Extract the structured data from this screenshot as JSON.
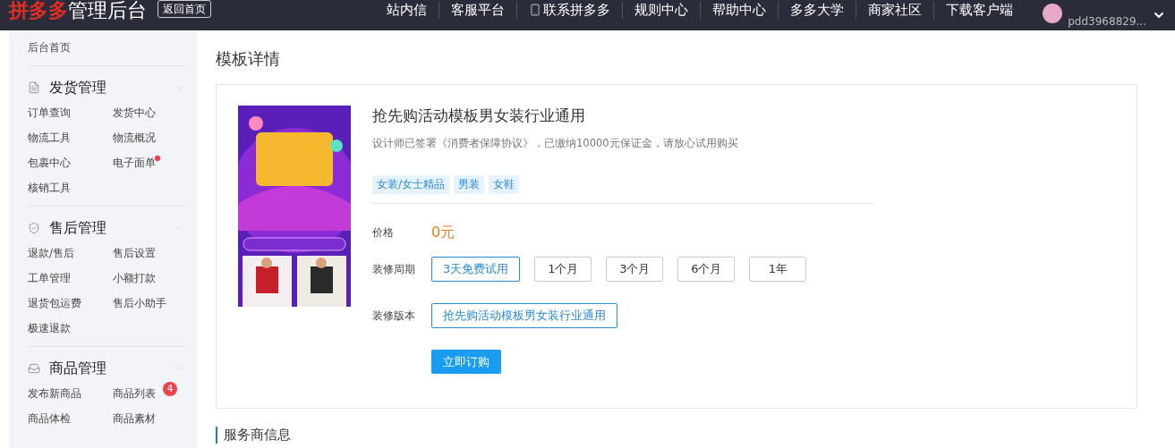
{
  "topbar": {
    "logo_brand": "拼多多",
    "logo_suffix": "管理后台",
    "home_button": "返回首页",
    "nav": [
      {
        "label": "站内信",
        "kind": "text"
      },
      {
        "label": "客服平台",
        "kind": "text"
      },
      {
        "label": "联系拼多多",
        "kind": "phone"
      },
      {
        "label": "规则中心",
        "kind": "text"
      },
      {
        "label": "帮助中心",
        "kind": "text"
      },
      {
        "label": "多多大学",
        "kind": "text"
      },
      {
        "label": "商家社区",
        "kind": "text"
      },
      {
        "label": "下载客户端",
        "kind": "text"
      }
    ],
    "user": {
      "id": "pdd3968829..."
    }
  },
  "sidebar": {
    "home": "后台首页",
    "groups": [
      {
        "title": "发货管理",
        "kind": "document",
        "items": [
          {
            "label": "订单查询",
            "new_dot": false
          },
          {
            "label": "发货中心",
            "new_dot": false
          },
          {
            "label": "物流工具",
            "new_dot": false
          },
          {
            "label": "物流概况",
            "new_dot": false
          },
          {
            "label": "包裹中心",
            "new_dot": false
          },
          {
            "label": "电子面单",
            "new_dot": true
          },
          {
            "label": "核销工具",
            "new_dot": false
          }
        ]
      },
      {
        "title": "售后管理",
        "kind": "shield",
        "items": [
          {
            "label": "退款/售后",
            "new_dot": false
          },
          {
            "label": "售后设置",
            "new_dot": false
          },
          {
            "label": "工单管理",
            "new_dot": false
          },
          {
            "label": "小额打款",
            "new_dot": false
          },
          {
            "label": "退货包运费",
            "new_dot": false
          },
          {
            "label": "售后小助手",
            "new_dot": false
          },
          {
            "label": "极速退款",
            "new_dot": false
          }
        ]
      },
      {
        "title": "商品管理",
        "kind": "tray",
        "items": [
          {
            "label": "发布新商品",
            "new_dot": false
          },
          {
            "label": "商品列表",
            "new_dot": false,
            "badge": "4"
          },
          {
            "label": "商品体检",
            "new_dot": false
          },
          {
            "label": "商品素材",
            "new_dot": false
          }
        ]
      }
    ]
  },
  "page": {
    "title": "模板详情",
    "template": {
      "name": "抢先购活动模板男女装行业通用",
      "note": "设计师已签署《消费者保障协议》，已缴纳10000元保证金，请放心试用购买",
      "tags": [
        "女装/女士精品",
        "男装",
        "女鞋"
      ],
      "price_label": "价格",
      "price": "0元",
      "period_label": "装修周期",
      "periods": [
        {
          "label": "3天免费试用",
          "selected": true
        },
        {
          "label": "1个月",
          "selected": false
        },
        {
          "label": "3个月",
          "selected": false
        },
        {
          "label": "6个月",
          "selected": false
        },
        {
          "label": "1年",
          "selected": false
        }
      ],
      "version_label": "装修版本",
      "versions": [
        {
          "label": "抢先购活动模板男女装行业通用",
          "selected": true
        }
      ],
      "order_button": "立即订购"
    },
    "section_title": "服务商信息"
  }
}
